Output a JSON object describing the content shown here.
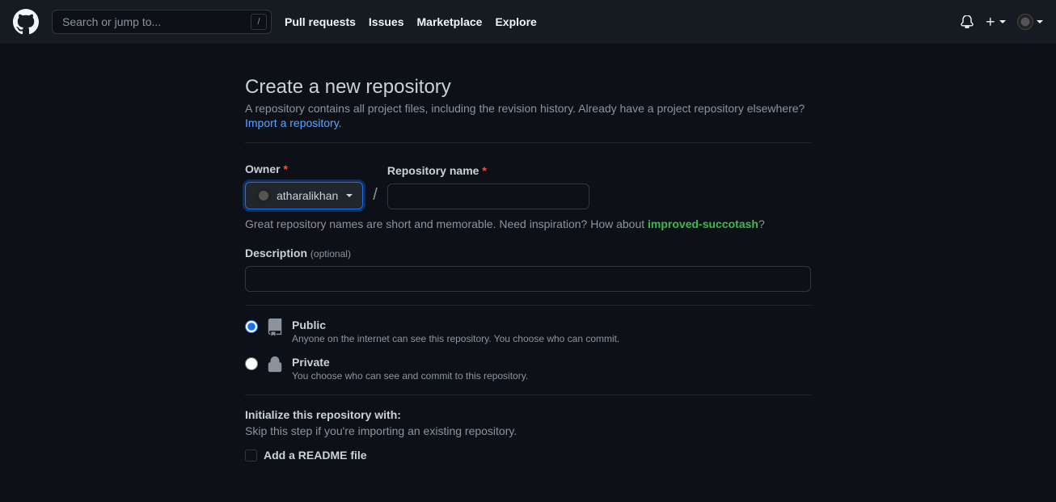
{
  "header": {
    "search_placeholder": "Search or jump to...",
    "slash_key": "/",
    "nav": [
      "Pull requests",
      "Issues",
      "Marketplace",
      "Explore"
    ]
  },
  "page": {
    "title": "Create a new repository",
    "subtitle": "A repository contains all project files, including the revision history. Already have a project repository elsewhere?",
    "import_link": "Import a repository."
  },
  "form": {
    "owner_label": "Owner",
    "owner_value": "atharalikhan",
    "slash": "/",
    "repo_name_label": "Repository name",
    "helper_text_1": "Great repository names are short and memorable. Need inspiration? How about ",
    "suggestion": "improved-succotash",
    "helper_text_2": "?",
    "description_label": "Description",
    "optional": "(optional)",
    "visibility": {
      "public": {
        "title": "Public",
        "desc": "Anyone on the internet can see this repository. You choose who can commit."
      },
      "private": {
        "title": "Private",
        "desc": "You choose who can see and commit to this repository."
      }
    },
    "init": {
      "heading": "Initialize this repository with:",
      "sub": "Skip this step if you're importing an existing repository.",
      "readme_label": "Add a README file"
    }
  }
}
